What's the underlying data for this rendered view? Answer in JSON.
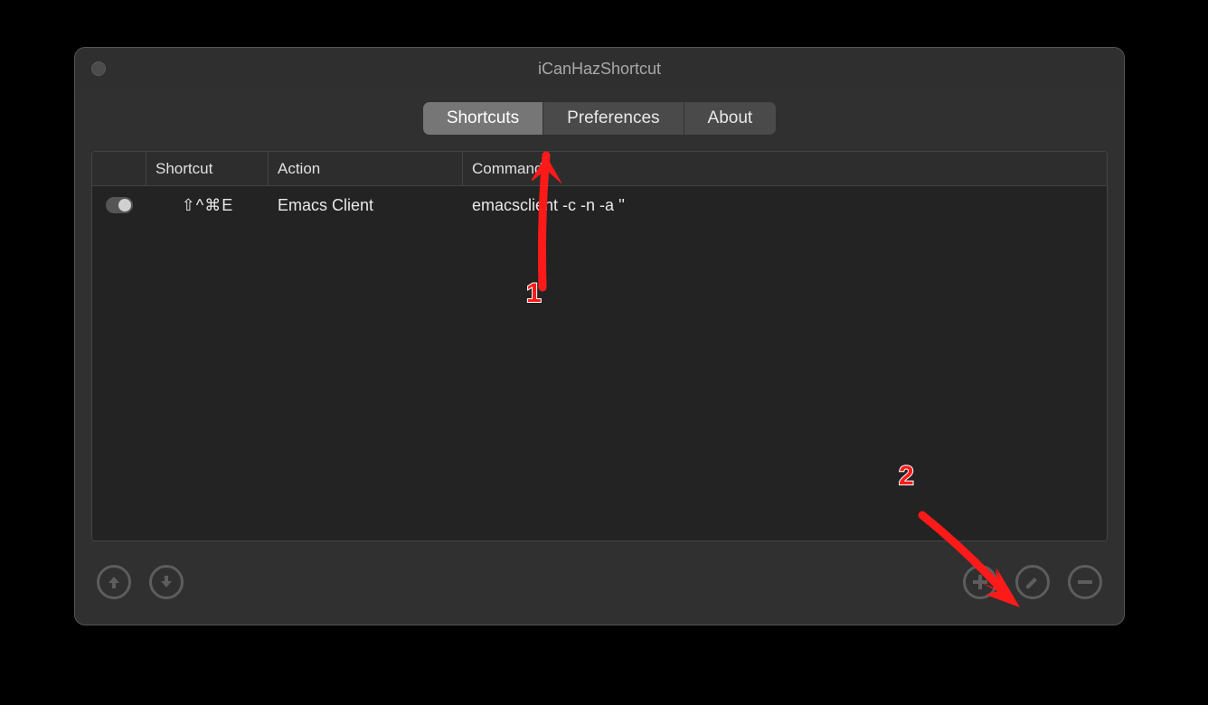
{
  "window": {
    "title": "iCanHazShortcut"
  },
  "tabs": [
    {
      "label": "Shortcuts",
      "active": true
    },
    {
      "label": "Preferences",
      "active": false
    },
    {
      "label": "About",
      "active": false
    }
  ],
  "table": {
    "columns": {
      "shortcut": "Shortcut",
      "action": "Action",
      "command": "Command"
    },
    "rows": [
      {
        "enabled": true,
        "shortcut": "⇧^⌘E",
        "action": "Emacs Client",
        "command": "emacsclient -c -n -a ''"
      }
    ]
  },
  "toolbar": {
    "move_up_icon": "arrow-up",
    "move_down_icon": "arrow-down",
    "add_icon": "plus",
    "edit_icon": "pencil",
    "remove_icon": "minus"
  },
  "annotations": [
    {
      "label": "1",
      "target": "tab-shortcuts"
    },
    {
      "label": "2",
      "target": "add-button"
    }
  ]
}
